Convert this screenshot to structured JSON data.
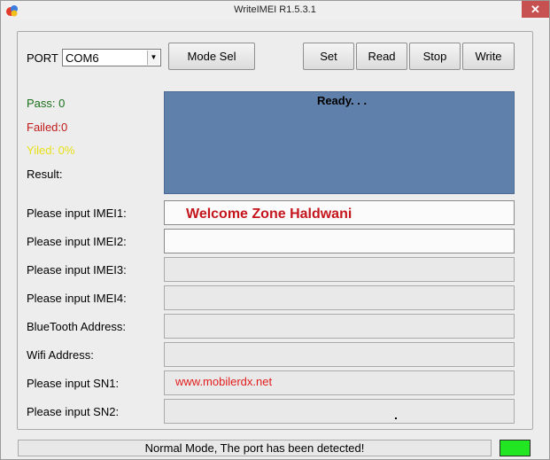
{
  "window": {
    "title": "WriteIMEI R1.5.3.1",
    "close_glyph": "✕"
  },
  "port": {
    "label": "PORT",
    "selected": "COM6"
  },
  "buttons": {
    "mode_sel": "Mode Sel",
    "set": "Set",
    "read": "Read",
    "stop": "Stop",
    "write": "Write"
  },
  "stats": {
    "pass": "Pass:  0",
    "failed": "Failed:0",
    "yiled": "Yiled:  0%",
    "result": "Result:"
  },
  "log": {
    "text": "Ready. . ."
  },
  "fields": [
    {
      "label": "Please input IMEI1:",
      "value": "Welcome Zone Haldwani"
    },
    {
      "label": "Please input IMEI2:",
      "value": ""
    },
    {
      "label": "Please input IMEI3:",
      "value": ""
    },
    {
      "label": "Please input IMEI4:",
      "value": ""
    },
    {
      "label": "BlueTooth Address:",
      "value": ""
    },
    {
      "label": "Wifi Address:",
      "value": ""
    },
    {
      "label": "Please input SN1:",
      "value": "www.mobilerdx.net"
    },
    {
      "label": "Please input SN2:",
      "value": ""
    }
  ],
  "status": {
    "text": "Normal Mode, The port has been detected!",
    "led_color": "#22e622"
  },
  "colors": {
    "log_panel": "#5f80aa",
    "pass": "#1a6f1a",
    "failed": "#c01a1a",
    "yiled": "#e8e01a"
  }
}
